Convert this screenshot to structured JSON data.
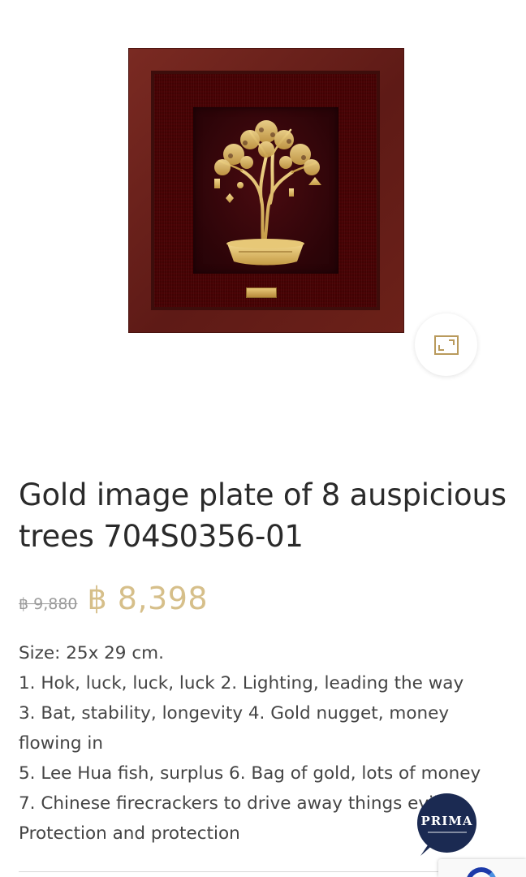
{
  "product": {
    "image_alt": "Gold image plate of 8 auspicious trees",
    "title": "Gold image plate of 8 auspicious trees 704S0356-01",
    "old_price": "฿ 9,880",
    "new_price": "฿ 8,398"
  },
  "description": {
    "lines": [
      "Size: 25x 29 cm.",
      "1. Hok, luck, luck, luck 2. Lighting, leading the way",
      "3. Bat, stability, longevity 4. Gold nugget, money",
      "flowing in",
      "5. Lee Hua fish, surplus 6. Bag of gold, lots of money",
      "7. Chinese firecrackers to drive away things evil",
      "Protection and protection"
    ]
  },
  "chat": {
    "brand": "PRIMA"
  },
  "icons": {
    "zoom": "expand-icon",
    "chat": "chat-badge-icon",
    "recaptcha": "recaptcha-icon"
  },
  "colors": {
    "price_accent": "#d6bf8a",
    "old_price": "#9a9a9a",
    "chat_badge": "#1b2a52",
    "title": "#2a2a2a"
  }
}
